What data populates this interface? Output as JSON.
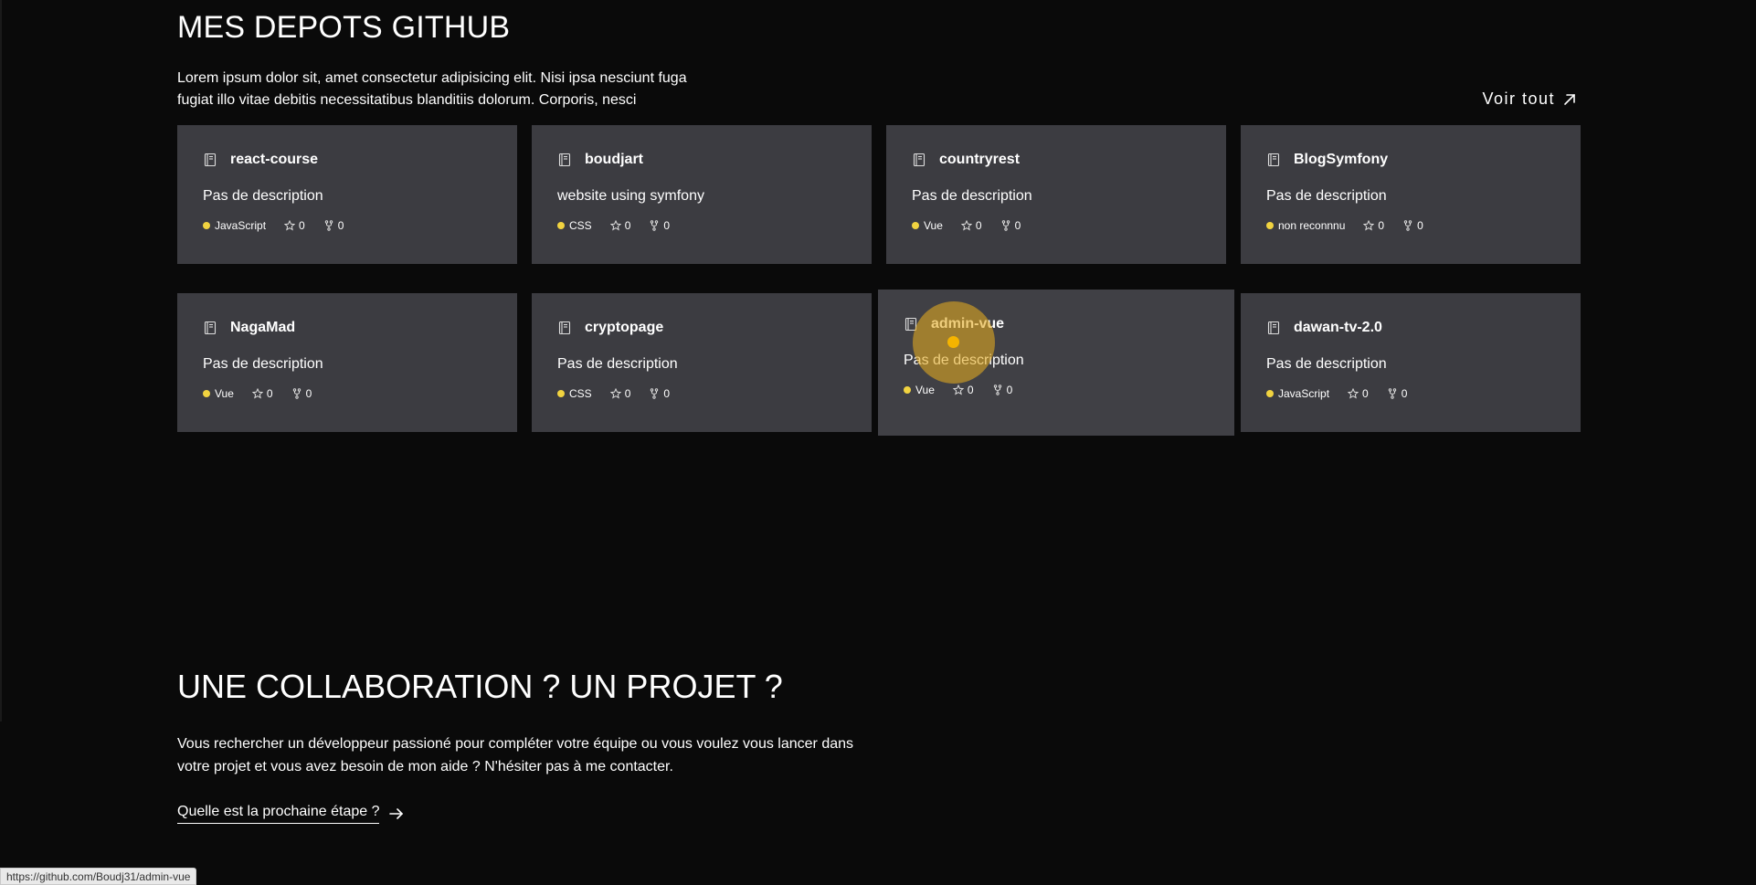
{
  "github_section": {
    "title": "MES DEPOTS GITHUB",
    "intro": "Lorem ipsum dolor sit, amet consectetur adipisicing elit. Nisi ipsa nesciunt fuga fugiat illo vitae debitis necessitatibus blanditiis dolorum. Corporis, nesci",
    "see_all_label": "Voir tout"
  },
  "repos": [
    {
      "name": "react-course",
      "description": "Pas de description",
      "language": "JavaScript",
      "stars": "0",
      "forks": "0"
    },
    {
      "name": "boudjart",
      "description": "website using symfony",
      "language": "CSS",
      "stars": "0",
      "forks": "0"
    },
    {
      "name": "countryrest",
      "description": "Pas de description",
      "language": "Vue",
      "stars": "0",
      "forks": "0"
    },
    {
      "name": "BlogSymfony",
      "description": "Pas de description",
      "language": "non reconnnu",
      "stars": "0",
      "forks": "0"
    },
    {
      "name": "NagaMad",
      "description": "Pas de description",
      "language": "Vue",
      "stars": "0",
      "forks": "0"
    },
    {
      "name": "cryptopage",
      "description": "Pas de description",
      "language": "CSS",
      "stars": "0",
      "forks": "0"
    },
    {
      "name": "admin-vue",
      "description": "Pas de description",
      "language": "Vue",
      "stars": "0",
      "forks": "0"
    },
    {
      "name": "dawan-tv-2.0",
      "description": "Pas de description",
      "language": "JavaScript",
      "stars": "0",
      "forks": "0"
    }
  ],
  "contact_section": {
    "title": "UNE COLLABORATION ? UN PROJET ?",
    "text": "Vous rechercher un développeur passioné pour compléter votre équipe ou vous voulez vous lancer dans votre projet et vous avez besoin de mon aide ? N'hésiter pas à me contacter.",
    "next_step_label": "Quelle est la prochaine étape ?"
  },
  "status_bar": {
    "url": "https://github.com/Boudj31/admin-vue"
  },
  "colors": {
    "background": "#0a0a0a",
    "card": "#3c3c41",
    "language_dot": "#f1d340",
    "click_highlight": "#e4ab1f"
  },
  "icons": {
    "repo": "repo-book-icon",
    "star": "star-icon",
    "fork": "fork-icon",
    "see_all": "arrow-up-right-icon",
    "next_step": "arrow-right-icon"
  }
}
